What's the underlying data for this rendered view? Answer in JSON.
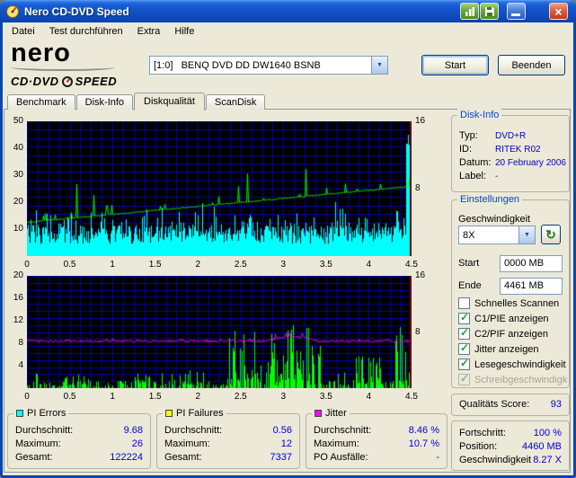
{
  "colors": {
    "frame": "#0B46B0",
    "value_text": "#0000CE",
    "grid": "#0000A8",
    "plot_bg": "#000000",
    "end_marker": "#7A0000"
  },
  "titlebar": {
    "title": "Nero CD-DVD Speed"
  },
  "menu": {
    "items": [
      "Datei",
      "Test durchführen",
      "Extra",
      "Hilfe"
    ]
  },
  "header": {
    "logo_line1": "nero",
    "logo_line2a": "CD·DVD",
    "logo_line2b": "SPEED",
    "drive": "[1:0]   BENQ DVD DD DW1640 BSNB",
    "start": "Start",
    "quit": "Beenden"
  },
  "tabs": [
    "Benchmark",
    "Disk-Info",
    "Diskqualität",
    "ScanDisk"
  ],
  "disk_info": {
    "title": "Disk-Info",
    "typ_label": "Typ:",
    "typ": "DVD+R",
    "id_label": "ID:",
    "id": "RITEK R02",
    "datum_label": "Datum:",
    "datum": "20 February 2006",
    "label_label": "Label:",
    "label": "-"
  },
  "settings": {
    "title": "Einstellungen",
    "speed_label": "Geschwindigkeit",
    "speed": "8X",
    "start_label": "Start",
    "start": "0000 MB",
    "ende_label": "Ende",
    "ende": "4461 MB",
    "cb": [
      {
        "label": "Schnelles Scannen",
        "checked": false,
        "disabled": false
      },
      {
        "label": "C1/PIE anzeigen",
        "checked": true,
        "disabled": false
      },
      {
        "label": "C2/PIF anzeigen",
        "checked": true,
        "disabled": false
      },
      {
        "label": "Jitter anzeigen",
        "checked": true,
        "disabled": false
      },
      {
        "label": "Lesegeschwindigkeit a",
        "checked": true,
        "disabled": false
      },
      {
        "label": "Schreibgeschwindigkei",
        "checked": true,
        "disabled": true
      }
    ]
  },
  "quality_score": {
    "label": "Qualitäts Score:",
    "value": "93"
  },
  "progress": {
    "fortschritt_label": "Fortschritt:",
    "fortschritt": "100 %",
    "position_label": "Position:",
    "position": "4460 MB",
    "speed_label": "Geschwindigkeit",
    "speed": "8.27 X"
  },
  "stats": [
    {
      "title": "PI Errors",
      "swatch": "#00FFFF",
      "rows": [
        {
          "label": "Durchschnitt:",
          "value": "9.68"
        },
        {
          "label": "Maximum:",
          "value": "26"
        },
        {
          "label": "Gesamt:",
          "value": "122224"
        }
      ]
    },
    {
      "title": "PI Failures",
      "swatch": "#FFFF00",
      "rows": [
        {
          "label": "Durchschnitt:",
          "value": "0.56"
        },
        {
          "label": "Maximum:",
          "value": "12"
        },
        {
          "label": "Gesamt:",
          "value": "7337"
        }
      ]
    },
    {
      "title": "Jitter",
      "swatch": "#FF00FF",
      "rows": [
        {
          "label": "Durchschnitt:",
          "value": "8.46 %"
        },
        {
          "label": "Maximum:",
          "value": "10.7 %"
        },
        {
          "label": "PO Ausfälle:",
          "value": "-"
        }
      ]
    }
  ],
  "chart_data": [
    {
      "id": "pi-errors-chart",
      "type": "area",
      "x_range": [
        0,
        4.5
      ],
      "x_ticks": [
        "0",
        "0.5",
        "1",
        "1.5",
        "2",
        "2.5",
        "3",
        "3.5",
        "4",
        "4.5"
      ],
      "y_left": {
        "range": [
          0,
          50
        ],
        "ticks": [
          "10",
          "20",
          "30",
          "40",
          "50"
        ]
      },
      "y_right": {
        "range": [
          0,
          16
        ],
        "ticks": [
          "8",
          "16"
        ]
      },
      "grid": {
        "x_div": 36,
        "y_div": 16
      },
      "series": [
        {
          "name": "PI Errors",
          "style": "area",
          "color": "#00FFFF",
          "axis": "left",
          "avg": 9.68,
          "max": 26,
          "total": 122224,
          "end_spike": 45
        },
        {
          "name": "Lesegeschwindigkeit",
          "style": "line",
          "color": "#00FF00",
          "axis": "right",
          "start": 4.0,
          "end": 8.27
        }
      ]
    },
    {
      "id": "pi-failures-jitter-chart",
      "type": "bars+line",
      "x_range": [
        0,
        4.5
      ],
      "x_ticks": [
        "0",
        "0.5",
        "1",
        "1.5",
        "2",
        "2.5",
        "3",
        "3.5",
        "4",
        "4.5"
      ],
      "y_left": {
        "range": [
          0,
          20
        ],
        "ticks": [
          "4",
          "8",
          "12",
          "16",
          "20"
        ]
      },
      "y_right": {
        "range": [
          0,
          16
        ],
        "ticks": [
          "8",
          "16"
        ]
      },
      "grid": {
        "x_div": 36,
        "y_div": 16
      },
      "series": [
        {
          "name": "PI Failures",
          "style": "bars",
          "color": "#00FF00",
          "axis": "left",
          "avg": 0.56,
          "max": 12,
          "total": 7337,
          "clusters": [
            [
              0.35,
              0.55,
              2.5
            ],
            [
              1.25,
              1.45,
              3
            ],
            [
              1.8,
              2.0,
              3.5
            ],
            [
              2.35,
              3.45,
              12
            ],
            [
              3.85,
              4.15,
              6
            ],
            [
              4.32,
              4.5,
              11
            ]
          ]
        },
        {
          "name": "Jitter",
          "style": "line",
          "color": "#FF00FF",
          "axis": "left",
          "avg": 8.46,
          "max": 10.7
        }
      ]
    }
  ]
}
